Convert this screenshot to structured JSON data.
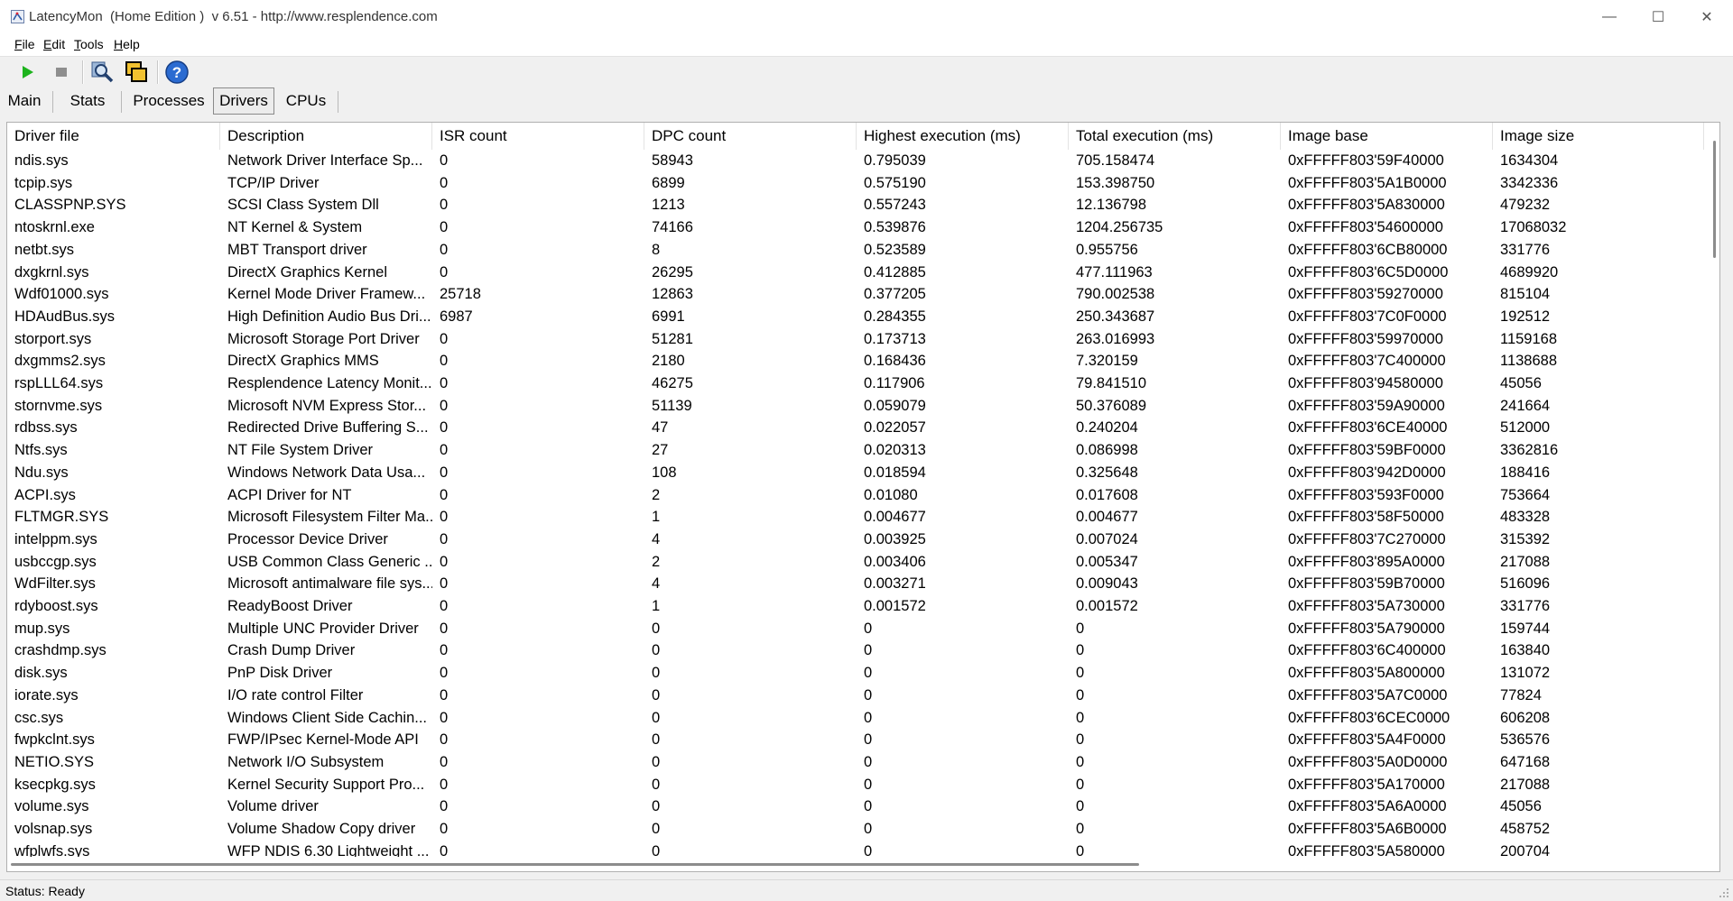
{
  "window": {
    "title": "LatencyMon  (Home Edition )  v 6.51 - http://www.resplendence.com",
    "minimize": "—",
    "maximize": "☐",
    "close": "✕"
  },
  "menu": [
    {
      "label": "File",
      "key": "F"
    },
    {
      "label": "Edit",
      "key": "E"
    },
    {
      "label": "Tools",
      "key": "T"
    },
    {
      "label": "Help",
      "key": "H"
    }
  ],
  "toolbar": {
    "start_icon": "play-icon",
    "stop_icon": "stop-icon",
    "search_icon": "search-icon",
    "windows_icon": "windows-icon",
    "help_icon": "help-icon"
  },
  "tabs": [
    {
      "label": "Main",
      "active": false
    },
    {
      "label": "Stats",
      "active": false
    },
    {
      "label": "Processes",
      "active": false
    },
    {
      "label": "Drivers",
      "active": true
    },
    {
      "label": "CPUs",
      "active": false
    }
  ],
  "table": {
    "columns": [
      "Driver file",
      "Description",
      "ISR count",
      "DPC count",
      "Highest execution (ms)",
      "Total execution (ms)",
      "Image base",
      "Image size"
    ],
    "rows": [
      [
        "ndis.sys",
        "Network Driver Interface Sp...",
        "0",
        "58943",
        "0.795039",
        "705.158474",
        "0xFFFFF803'59F40000",
        "1634304"
      ],
      [
        "tcpip.sys",
        "TCP/IP Driver",
        "0",
        "6899",
        "0.575190",
        "153.398750",
        "0xFFFFF803'5A1B0000",
        "3342336"
      ],
      [
        "CLASSPNP.SYS",
        "SCSI Class System Dll",
        "0",
        "1213",
        "0.557243",
        "12.136798",
        "0xFFFFF803'5A830000",
        "479232"
      ],
      [
        "ntoskrnl.exe",
        "NT Kernel & System",
        "0",
        "74166",
        "0.539876",
        "1204.256735",
        "0xFFFFF803'54600000",
        "17068032"
      ],
      [
        "netbt.sys",
        "MBT Transport driver",
        "0",
        "8",
        "0.523589",
        "0.955756",
        "0xFFFFF803'6CB80000",
        "331776"
      ],
      [
        "dxgkrnl.sys",
        "DirectX Graphics Kernel",
        "0",
        "26295",
        "0.412885",
        "477.111963",
        "0xFFFFF803'6C5D0000",
        "4689920"
      ],
      [
        "Wdf01000.sys",
        "Kernel Mode Driver Framew...",
        "25718",
        "12863",
        "0.377205",
        "790.002538",
        "0xFFFFF803'59270000",
        "815104"
      ],
      [
        "HDAudBus.sys",
        "High Definition Audio Bus Dri...",
        "6987",
        "6991",
        "0.284355",
        "250.343687",
        "0xFFFFF803'7C0F0000",
        "192512"
      ],
      [
        "storport.sys",
        "Microsoft Storage Port Driver",
        "0",
        "51281",
        "0.173713",
        "263.016993",
        "0xFFFFF803'59970000",
        "1159168"
      ],
      [
        "dxgmms2.sys",
        "DirectX Graphics MMS",
        "0",
        "2180",
        "0.168436",
        "7.320159",
        "0xFFFFF803'7C400000",
        "1138688"
      ],
      [
        "rspLLL64.sys",
        "Resplendence Latency Monit...",
        "0",
        "46275",
        "0.117906",
        "79.841510",
        "0xFFFFF803'94580000",
        "45056"
      ],
      [
        "stornvme.sys",
        "Microsoft NVM Express Stor...",
        "0",
        "51139",
        "0.059079",
        "50.376089",
        "0xFFFFF803'59A90000",
        "241664"
      ],
      [
        "rdbss.sys",
        "Redirected Drive Buffering S...",
        "0",
        "47",
        "0.022057",
        "0.240204",
        "0xFFFFF803'6CE40000",
        "512000"
      ],
      [
        "Ntfs.sys",
        "NT File System Driver",
        "0",
        "27",
        "0.020313",
        "0.086998",
        "0xFFFFF803'59BF0000",
        "3362816"
      ],
      [
        "Ndu.sys",
        "Windows Network Data Usa...",
        "0",
        "108",
        "0.018594",
        "0.325648",
        "0xFFFFF803'942D0000",
        "188416"
      ],
      [
        "ACPI.sys",
        "ACPI Driver for NT",
        "0",
        "2",
        "0.01080",
        "0.017608",
        "0xFFFFF803'593F0000",
        "753664"
      ],
      [
        "FLTMGR.SYS",
        "Microsoft Filesystem Filter Ma...",
        "0",
        "1",
        "0.004677",
        "0.004677",
        "0xFFFFF803'58F50000",
        "483328"
      ],
      [
        "intelppm.sys",
        "Processor Device Driver",
        "0",
        "4",
        "0.003925",
        "0.007024",
        "0xFFFFF803'7C270000",
        "315392"
      ],
      [
        "usbccgp.sys",
        "USB Common Class Generic ...",
        "0",
        "2",
        "0.003406",
        "0.005347",
        "0xFFFFF803'895A0000",
        "217088"
      ],
      [
        "WdFilter.sys",
        "Microsoft antimalware file sys...",
        "0",
        "4",
        "0.003271",
        "0.009043",
        "0xFFFFF803'59B70000",
        "516096"
      ],
      [
        "rdyboost.sys",
        "ReadyBoost Driver",
        "0",
        "1",
        "0.001572",
        "0.001572",
        "0xFFFFF803'5A730000",
        "331776"
      ],
      [
        "mup.sys",
        "Multiple UNC Provider Driver",
        "0",
        "0",
        "0",
        "0",
        "0xFFFFF803'5A790000",
        "159744"
      ],
      [
        "crashdmp.sys",
        "Crash Dump Driver",
        "0",
        "0",
        "0",
        "0",
        "0xFFFFF803'6C400000",
        "163840"
      ],
      [
        "disk.sys",
        "PnP Disk Driver",
        "0",
        "0",
        "0",
        "0",
        "0xFFFFF803'5A800000",
        "131072"
      ],
      [
        "iorate.sys",
        "I/O rate control Filter",
        "0",
        "0",
        "0",
        "0",
        "0xFFFFF803'5A7C0000",
        "77824"
      ],
      [
        "csc.sys",
        "Windows Client Side Cachin...",
        "0",
        "0",
        "0",
        "0",
        "0xFFFFF803'6CEC0000",
        "606208"
      ],
      [
        "fwpkclnt.sys",
        "FWP/IPsec Kernel-Mode API",
        "0",
        "0",
        "0",
        "0",
        "0xFFFFF803'5A4F0000",
        "536576"
      ],
      [
        "NETIO.SYS",
        "Network I/O Subsystem",
        "0",
        "0",
        "0",
        "0",
        "0xFFFFF803'5A0D0000",
        "647168"
      ],
      [
        "ksecpkg.sys",
        "Kernel Security Support Pro...",
        "0",
        "0",
        "0",
        "0",
        "0xFFFFF803'5A170000",
        "217088"
      ],
      [
        "volume.sys",
        "Volume driver",
        "0",
        "0",
        "0",
        "0",
        "0xFFFFF803'5A6A0000",
        "45056"
      ],
      [
        "volsnap.sys",
        "Volume Shadow Copy driver",
        "0",
        "0",
        "0",
        "0",
        "0xFFFFF803'5A6B0000",
        "458752"
      ],
      [
        "wfplwfs.sys",
        "WFP NDIS 6.30 Lightweight ...",
        "0",
        "0",
        "0",
        "0",
        "0xFFFFF803'5A580000",
        "200704"
      ]
    ]
  },
  "status": {
    "text": "Status: Ready"
  }
}
